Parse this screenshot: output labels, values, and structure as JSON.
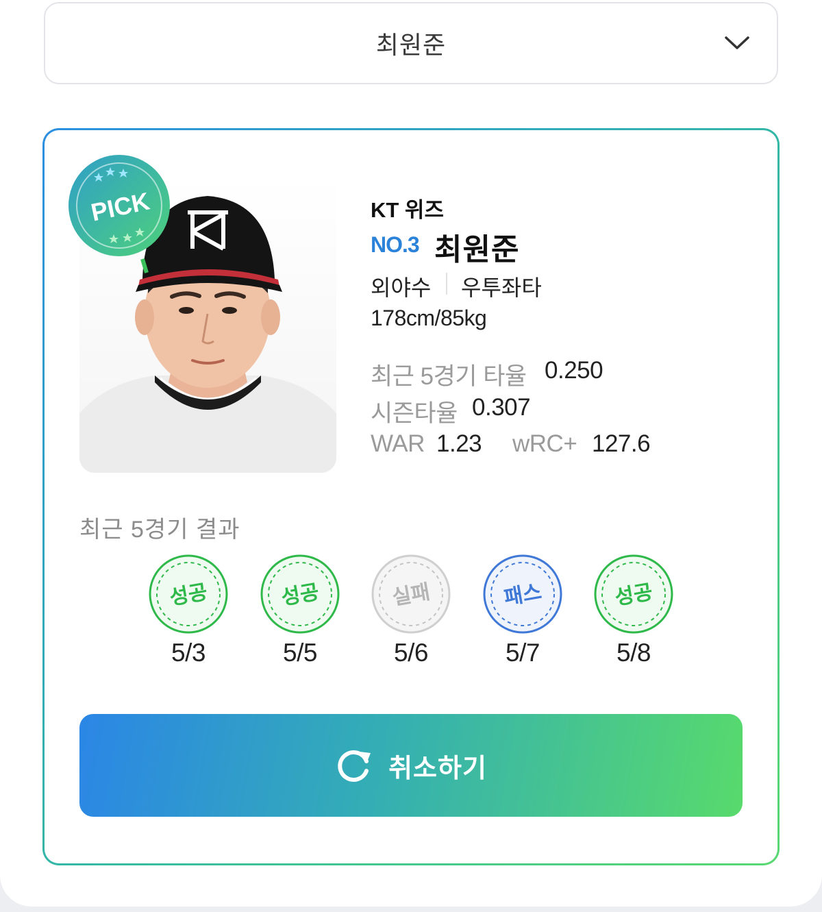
{
  "selector": {
    "selected": "최원준",
    "icon": "chevron-down-icon"
  },
  "player": {
    "badge": "PICK",
    "team": "KT 위즈",
    "number": "NO.3",
    "name": "최원준",
    "position": "외야수",
    "bat_throw": "우투좌타",
    "body": "178cm/85kg",
    "photo_alt_icon": "player-photo"
  },
  "stats": {
    "recent_avg_label": "최근 5경기 타율",
    "recent_avg_value": "0.250",
    "season_avg_label": "시즌타율",
    "season_avg_value": "0.307",
    "war_label": "WAR",
    "war_value": "1.23",
    "wrc_label": "wRC+",
    "wrc_value": "127.6"
  },
  "recent": {
    "title": "최근 5경기 결과",
    "games": [
      {
        "result": "성공",
        "date": "5/3",
        "type": "success"
      },
      {
        "result": "성공",
        "date": "5/5",
        "type": "success"
      },
      {
        "result": "실패",
        "date": "5/6",
        "type": "fail"
      },
      {
        "result": "패스",
        "date": "5/7",
        "type": "pass"
      },
      {
        "result": "성공",
        "date": "5/8",
        "type": "success"
      }
    ]
  },
  "actions": {
    "cancel_label": "취소하기",
    "cancel_icon": "refresh-icon"
  },
  "colors": {
    "accent_blue": "#2b82d9",
    "success": "#2fb94a",
    "fail": "#b5b5b5",
    "pass": "#3f78d6",
    "gradient_start": "#2b86e6",
    "gradient_end": "#58da6c"
  }
}
